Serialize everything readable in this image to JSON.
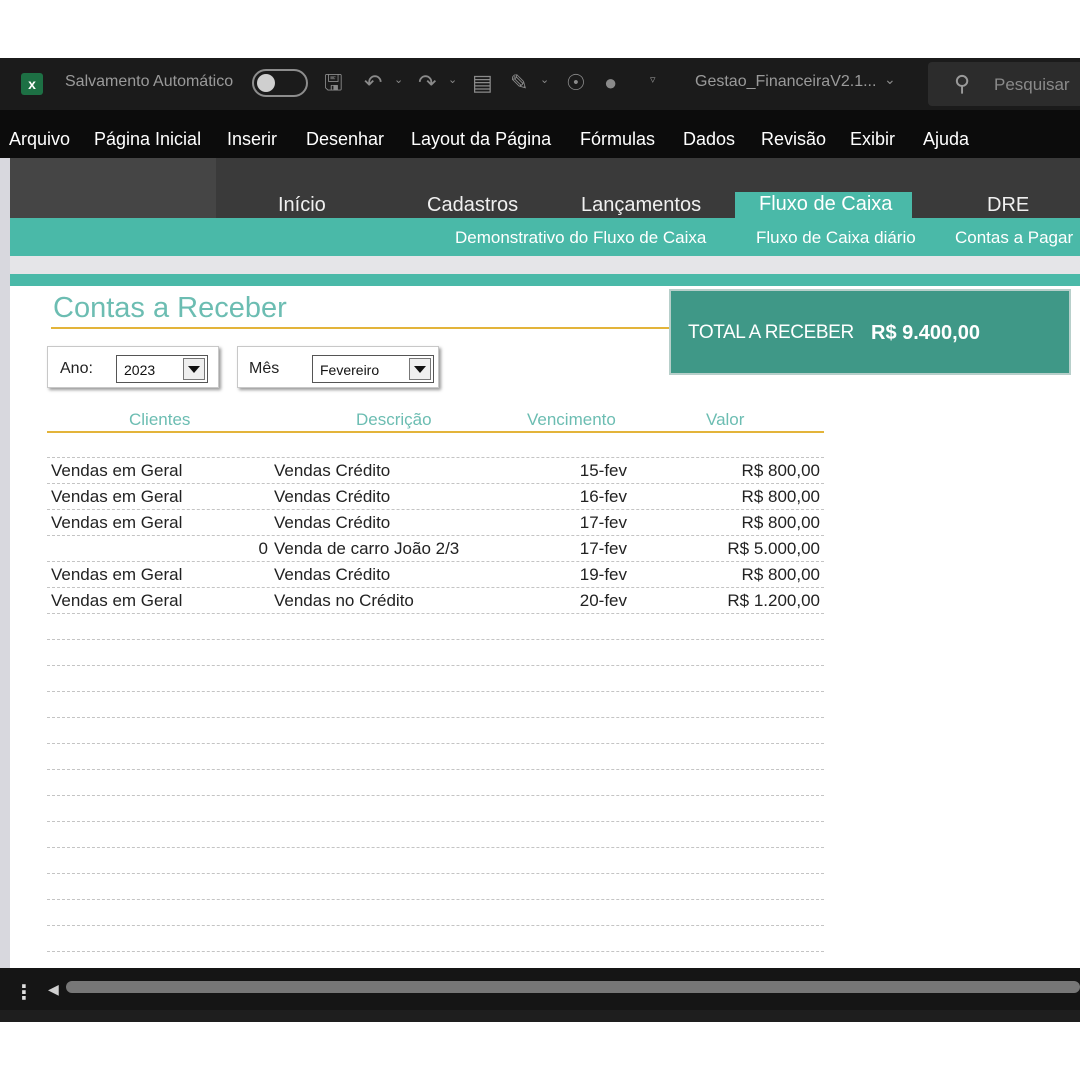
{
  "titlebar": {
    "app_icon": "excel-icon",
    "autosave_label": "Salvamento Automático",
    "autosave_on": false,
    "filename": "Gestao_FinanceiraV2.1...",
    "search_placeholder": "Pesquisar"
  },
  "menu": [
    "Arquivo",
    "Página Inicial",
    "Inserir",
    "Desenhar",
    "Layout da Página",
    "Fórmulas",
    "Dados",
    "Revisão",
    "Exibir",
    "Ajuda"
  ],
  "nav": {
    "tabs": [
      "Início",
      "Cadastros",
      "Lançamentos",
      "Fluxo de Caixa",
      "DRE"
    ],
    "active_tab": "Fluxo de Caixa",
    "subtabs": [
      "Demonstrativo do Fluxo de Caixa",
      "Fluxo de Caixa diário",
      "Contas a Pagar"
    ]
  },
  "page": {
    "title": "Contas a Receber",
    "total_label": "TOTAL A RECEBER",
    "total_value": "R$ 9.400,00"
  },
  "filters": {
    "year_label": "Ano:",
    "year_value": "2023",
    "month_label": "Mês",
    "month_value": "Fevereiro"
  },
  "table": {
    "headers": [
      "Clientes",
      "Descrição",
      "Vencimento",
      "Valor"
    ],
    "rows": [
      {
        "cliente": "Vendas em Geral",
        "descricao": "Vendas Crédito",
        "vencimento": "15-fev",
        "valor": "R$ 800,00"
      },
      {
        "cliente": "Vendas em Geral",
        "descricao": "Vendas Crédito",
        "vencimento": "16-fev",
        "valor": "R$ 800,00"
      },
      {
        "cliente": "Vendas em Geral",
        "descricao": "Vendas Crédito",
        "vencimento": "17-fev",
        "valor": "R$ 800,00"
      },
      {
        "cliente": "0",
        "descricao": "Venda de carro João 2/3",
        "vencimento": "17-fev",
        "valor": "R$ 5.000,00"
      },
      {
        "cliente": "Vendas em Geral",
        "descricao": "Vendas Crédito",
        "vencimento": "19-fev",
        "valor": "R$ 800,00"
      },
      {
        "cliente": "Vendas em Geral",
        "descricao": "Vendas no Crédito",
        "vencimento": "20-fev",
        "valor": "R$ 1.200,00"
      }
    ]
  },
  "colors": {
    "teal": "#4ab9a8",
    "teal_dark": "#3f9887",
    "gold": "#e3b43a",
    "header_text": "#6cbdb2"
  }
}
